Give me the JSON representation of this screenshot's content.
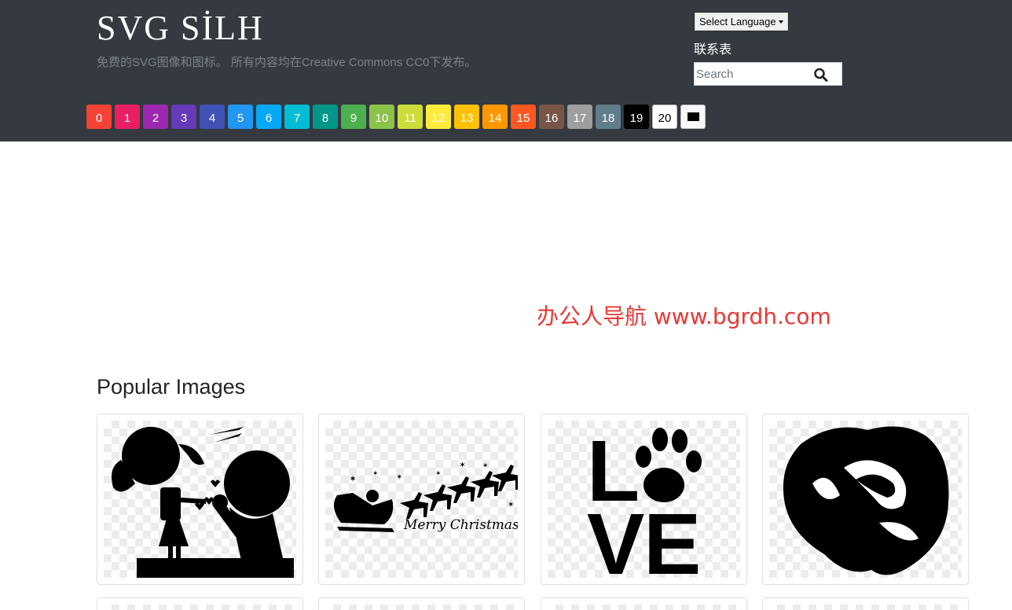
{
  "header": {
    "logo": "SVG SİLH",
    "tagline": "免费的SVG图像和图标。 所有内容均在Creative Commons CC0下发布。",
    "language_select": "Select Language",
    "contact_link": "联系表",
    "search_placeholder": "Search",
    "search_icon": "search-icon"
  },
  "color_filters": [
    {
      "label": "0",
      "color": "#f44336"
    },
    {
      "label": "1",
      "color": "#e91e63"
    },
    {
      "label": "2",
      "color": "#9c27b0"
    },
    {
      "label": "3",
      "color": "#673ab7"
    },
    {
      "label": "4",
      "color": "#3f51b5"
    },
    {
      "label": "5",
      "color": "#2196f3"
    },
    {
      "label": "6",
      "color": "#03a9f4"
    },
    {
      "label": "7",
      "color": "#00bcd4"
    },
    {
      "label": "8",
      "color": "#009688"
    },
    {
      "label": "9",
      "color": "#4caf50"
    },
    {
      "label": "10",
      "color": "#8bc34a"
    },
    {
      "label": "11",
      "color": "#cddc39"
    },
    {
      "label": "12",
      "color": "#ffeb3b"
    },
    {
      "label": "13",
      "color": "#ffc107"
    },
    {
      "label": "14",
      "color": "#ff9800"
    },
    {
      "label": "15",
      "color": "#ff5722"
    },
    {
      "label": "16",
      "color": "#795548"
    },
    {
      "label": "17",
      "color": "#9e9e9e"
    },
    {
      "label": "18",
      "color": "#607d8b"
    },
    {
      "label": "19",
      "color": "#000000"
    },
    {
      "label": "20",
      "color": "#ffffff"
    }
  ],
  "ad_banner": "办公人导航  www.bgrdh.com",
  "main": {
    "section_title": "Popular Images",
    "cards": [
      {
        "name": "couple-silhouette",
        "icon": "couple-flowers-icon"
      },
      {
        "name": "christmas-sleigh",
        "icon": "santa-sleigh-icon",
        "caption": "Merry Christmas"
      },
      {
        "name": "love-paw",
        "icon": "love-paw-icon",
        "letters": [
          "L",
          "V",
          "E"
        ]
      },
      {
        "name": "rose",
        "icon": "rose-icon"
      }
    ]
  }
}
